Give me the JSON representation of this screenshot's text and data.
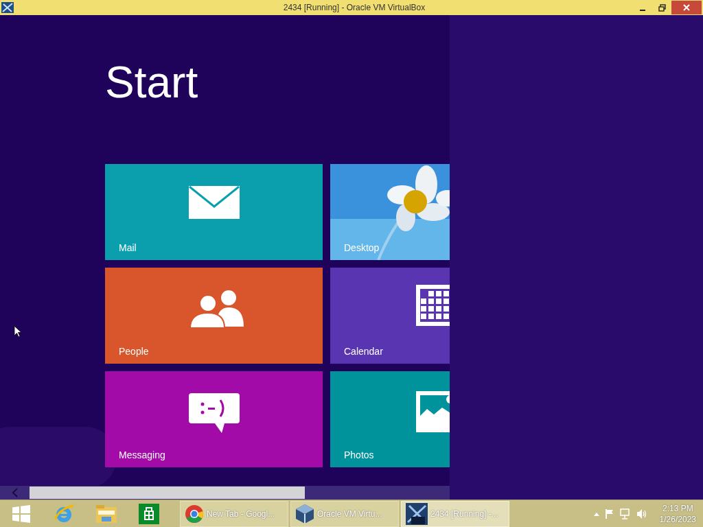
{
  "window": {
    "title": "2434 [Running] - Oracle VM VirtualBox"
  },
  "start": {
    "title": "Start"
  },
  "tiles": [
    {
      "label": "Mail",
      "kind": "mail",
      "color": "#0b9fae"
    },
    {
      "label": "Desktop",
      "kind": "picture"
    },
    {
      "label": "People",
      "kind": "people",
      "color": "#d9552b"
    },
    {
      "label": "Calendar",
      "kind": "calendar",
      "color": "#5a35b1"
    },
    {
      "label": "Messaging",
      "kind": "messaging",
      "color": "#a20ba8"
    },
    {
      "label": "Photos",
      "kind": "photos",
      "color": "#00939c"
    }
  ],
  "taskbar": {
    "pinned": [
      {
        "kind": "start"
      },
      {
        "kind": "browser"
      },
      {
        "kind": "explorer"
      },
      {
        "kind": "store"
      }
    ],
    "tasks": [
      {
        "label": "New Tab - Googl...",
        "kind": "chrome",
        "selected": false
      },
      {
        "label": "Oracle VM Virtu...",
        "kind": "virtualbox",
        "selected": false
      },
      {
        "label": "2434 [Running] -...",
        "kind": "vm",
        "selected": true
      }
    ],
    "time": "2:13 PM",
    "date": "1/26/2023"
  }
}
